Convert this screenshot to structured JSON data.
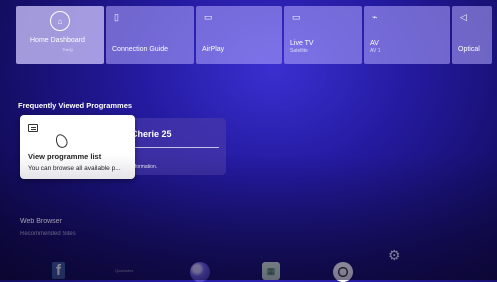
{
  "top_row": {
    "tiles": [
      {
        "label": "Home Dashboard",
        "sub": "ThinQ",
        "icon": "home-dashboard-icon"
      },
      {
        "label": "Connection Guide",
        "icon": "phone-icon"
      },
      {
        "label": "AirPlay",
        "icon": "airplay-icon"
      },
      {
        "label": "Live TV",
        "sub": "Satellite",
        "icon": "tv-icon"
      },
      {
        "label": "AV",
        "sub": "AV 1",
        "icon": "av-icon"
      },
      {
        "label": "Optical",
        "icon": "speaker-icon"
      }
    ]
  },
  "frequently_viewed": {
    "title": "Frequently Viewed Programmes",
    "programme": {
      "name": "Cherie 25",
      "info": "information."
    }
  },
  "tooltip": {
    "title": "View programme list",
    "description": "You can browse all available p..."
  },
  "web_browser": {
    "title": "Web Browser",
    "subtitle": "Recommended Sites"
  },
  "apps": {
    "facebook": "f",
    "text_app": "Quadrolex"
  },
  "colors": {
    "background": "#241aa0",
    "tile": "#b4aaff",
    "tooltip": "#ffffff"
  }
}
